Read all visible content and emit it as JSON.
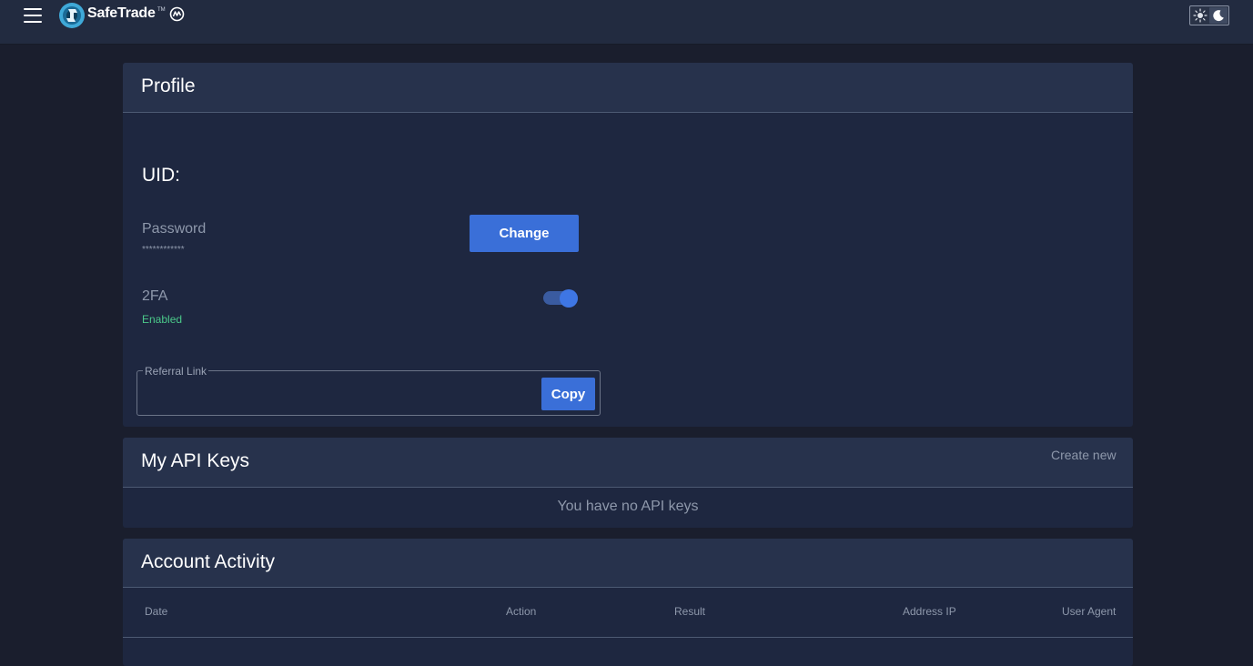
{
  "header": {
    "brand_name": "SafeTrade",
    "brand_tm": "TM",
    "icons": [
      "hamburger-icon",
      "safetrade-logo-icon",
      "coinmarketcap-icon",
      "sun-icon",
      "moon-icon"
    ]
  },
  "profile": {
    "title": "Profile",
    "uid_label": "UID:",
    "password_label": "Password",
    "password_value": "************",
    "change_label": "Change",
    "tfa_label": "2FA",
    "tfa_status": "Enabled",
    "tfa_enabled": true,
    "referral_label": "Referral Link",
    "referral_value": "",
    "copy_label": "Copy"
  },
  "api_keys": {
    "title": "My API Keys",
    "create_label": "Create new",
    "empty_text": "You have no API keys"
  },
  "activity": {
    "title": "Account Activity",
    "columns": [
      "Date",
      "Action",
      "Result",
      "Address IP",
      "User Agent"
    ]
  },
  "colors": {
    "page_bg": "#1a1e2d",
    "card_bg": "#1e2740",
    "header_bg": "#27324c",
    "accent": "#3a6fd8",
    "success": "#4bc98a",
    "muted": "#8e98ab"
  }
}
